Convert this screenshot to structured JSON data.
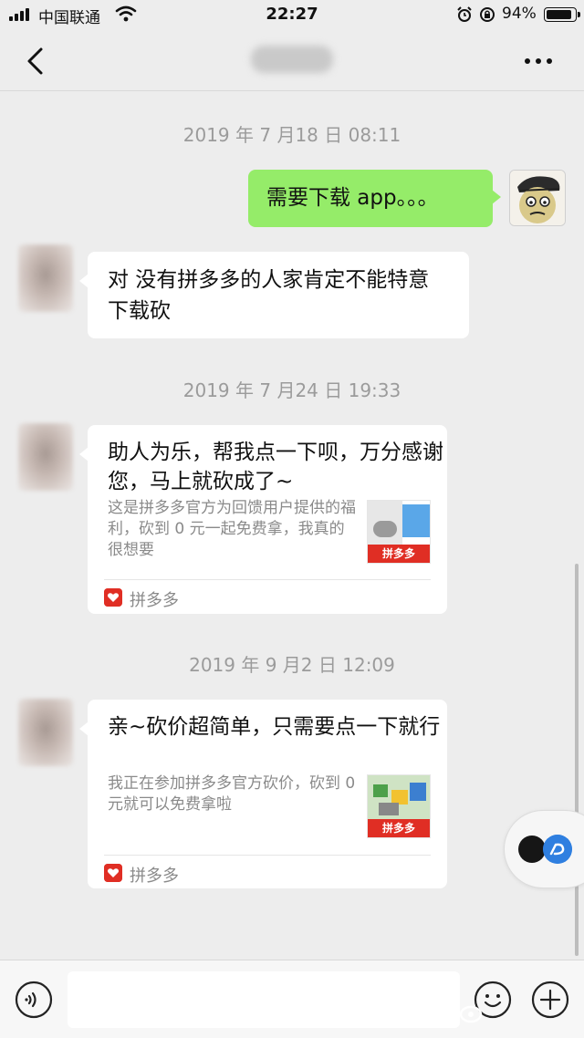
{
  "status_bar": {
    "carrier": "中国联通",
    "time": "22:27",
    "battery": "94%",
    "battery_level": 0.94
  },
  "nav": {
    "back_icon": "chevron-left-icon",
    "title": "",
    "more_icon": "ellipsis-icon"
  },
  "messages": [
    {
      "type": "timestamp",
      "text": "2019 年 7 月18 日 08:11"
    },
    {
      "type": "text",
      "side": "right",
      "text": "需要下载 app。。。"
    },
    {
      "type": "text",
      "side": "left",
      "text": "对 没有拼多多的人家肯定不能特意下载砍"
    },
    {
      "type": "timestamp",
      "text": "2019 年 7 月24 日 19:33"
    },
    {
      "type": "share_card",
      "side": "left",
      "title": "助人为乐，帮我点一下呗，万分感谢您，马上就砍成了~",
      "description": "这是拼多多官方为回馈用户提供的福利，砍到 0 元一起免费拿，我真的很想要",
      "thumb_banner": "拼多多",
      "source": "拼多多"
    },
    {
      "type": "timestamp",
      "text": "2019 年 9 月2 日 12:09"
    },
    {
      "type": "share_card",
      "side": "left",
      "title": "亲~砍价超简单，只需要点一下就行",
      "description": "我正在参加拼多多官方砍价，砍到 0 元就可以免费拿啦",
      "thumb_banner": "拼多多",
      "source": "拼多多"
    }
  ],
  "input_bar": {
    "voice_icon": "voice-icon",
    "input_value": "",
    "emoji_icon": "emoji-icon",
    "plus_icon": "plus-icon"
  },
  "colors": {
    "sent_bubble": "#95ec69",
    "received_bubble": "#ffffff",
    "background": "#ededed",
    "brand_red": "#e02e24"
  }
}
